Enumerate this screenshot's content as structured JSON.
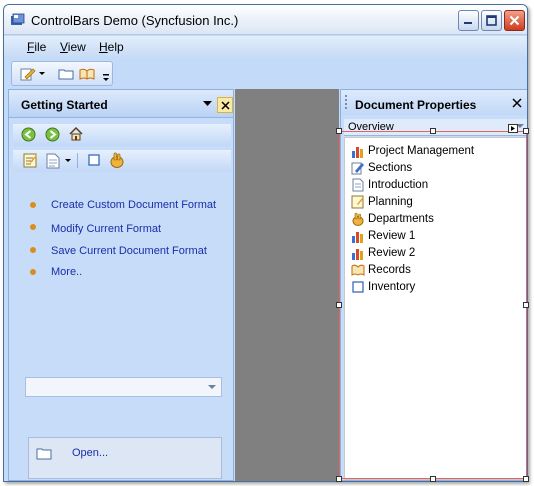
{
  "window": {
    "title": "ControlBars Demo (Syncfusion Inc.)",
    "accent": "#c3daf9"
  },
  "menu": {
    "items": [
      {
        "label": "File",
        "mnemonic": "F",
        "rest": "ile"
      },
      {
        "label": "View",
        "mnemonic": "V",
        "rest": "iew"
      },
      {
        "label": "Help",
        "mnemonic": "H",
        "rest": "elp"
      }
    ]
  },
  "toolbar": {
    "icons": [
      "edit-icon",
      "folder-icon",
      "book-icon",
      "overflow-icon"
    ]
  },
  "left_panel": {
    "title": "Getting Started",
    "nav_icons": [
      "back-icon",
      "forward-icon",
      "home-icon"
    ],
    "tool_icons": [
      "notes-icon",
      "document-icon",
      "box-icon",
      "hand-icon"
    ],
    "tasks": [
      {
        "label": "Create Custom Document Format"
      },
      {
        "label": "Modify Current Format"
      },
      {
        "label": "Save Current Document Format"
      },
      {
        "label": "More.."
      }
    ],
    "combo_value": "",
    "open_label": "Open..."
  },
  "right_panel": {
    "title": "Document Properties",
    "combo_value": "Overview",
    "items": [
      {
        "label": "Project Management",
        "icon": "chart-icon"
      },
      {
        "label": "Sections",
        "icon": "edit-icon"
      },
      {
        "label": "Introduction",
        "icon": "document-icon"
      },
      {
        "label": "Planning",
        "icon": "notes-icon"
      },
      {
        "label": "Departments",
        "icon": "hand-icon"
      },
      {
        "label": "Review 1",
        "icon": "chart-icon"
      },
      {
        "label": "Review 2",
        "icon": "chart-icon"
      },
      {
        "label": "Records",
        "icon": "book-icon"
      },
      {
        "label": "Inventory",
        "icon": "box-icon"
      }
    ]
  }
}
